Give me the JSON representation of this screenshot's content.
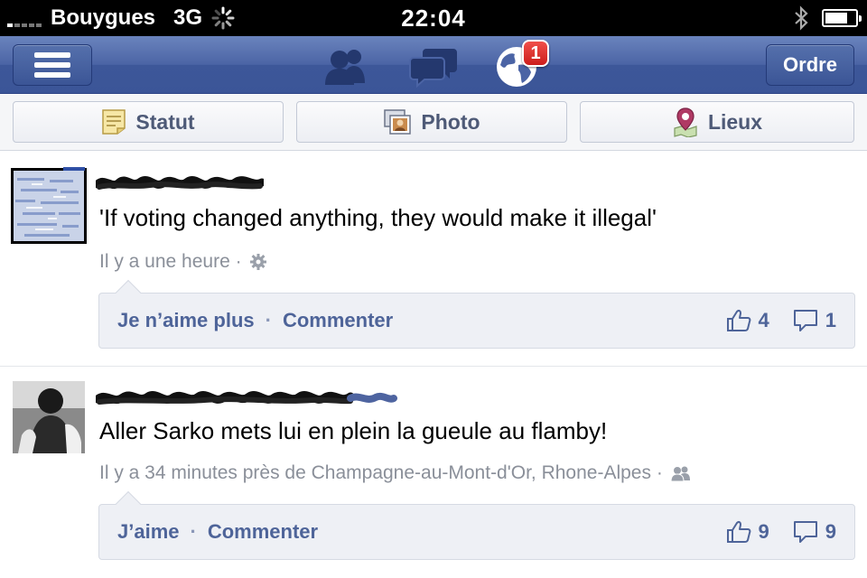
{
  "status_bar": {
    "carrier": "Bouygues",
    "network": "3G",
    "time": "22:04",
    "battery_level": 0.75
  },
  "nav_bar": {
    "notification_count": "1",
    "right_button_label": "Ordre",
    "icons": [
      "menu-icon",
      "friend-requests-icon",
      "messages-icon",
      "notifications-globe-icon"
    ]
  },
  "publisher": {
    "status_label": "Statut",
    "photo_label": "Photo",
    "places_label": "Lieux"
  },
  "feed": {
    "stories": [
      {
        "text": "'If voting changed anything, they would make it illegal'",
        "meta": "Il y a une heure ·",
        "privacy_icon": "gear-icon",
        "like_action": "Je n’aime plus",
        "comment_action": "Commenter",
        "likes": "4",
        "comments": "1"
      },
      {
        "text": "Aller Sarko mets lui en plein la gueule au flamby!",
        "meta": "Il y a 34 minutes près de Champagne-au-Mont-d'Or, Rhone-Alpes ·",
        "privacy_icon": "friends-icon",
        "like_action": "J’aime",
        "comment_action": "Commenter",
        "likes": "9",
        "comments": "9"
      }
    ]
  },
  "colors": {
    "nav_blue": "#3b5598",
    "link_blue": "#4e6499",
    "badge_red": "#e0302c",
    "meta_gray": "#8a8f99"
  }
}
